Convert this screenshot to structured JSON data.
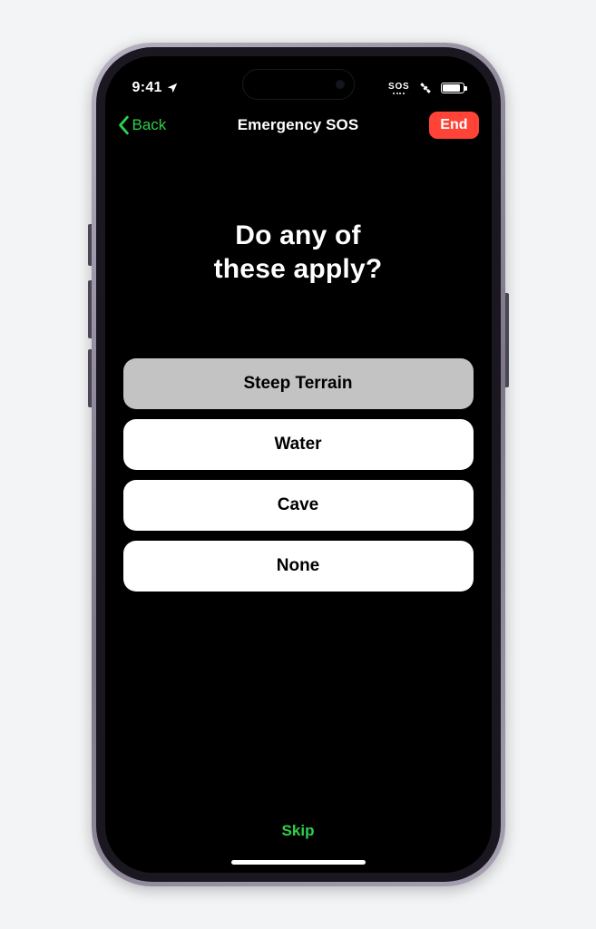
{
  "status": {
    "time": "9:41",
    "sos_label": "SOS"
  },
  "nav": {
    "back_label": "Back",
    "title": "Emergency SOS",
    "end_label": "End"
  },
  "question_line1": "Do any of",
  "question_line2": "these apply?",
  "options": [
    {
      "label": "Steep Terrain",
      "selected": true
    },
    {
      "label": "Water",
      "selected": false
    },
    {
      "label": "Cave",
      "selected": false
    },
    {
      "label": "None",
      "selected": false
    }
  ],
  "skip_label": "Skip",
  "colors": {
    "accent_green": "#2fcf4a",
    "end_red": "#ff4336"
  }
}
